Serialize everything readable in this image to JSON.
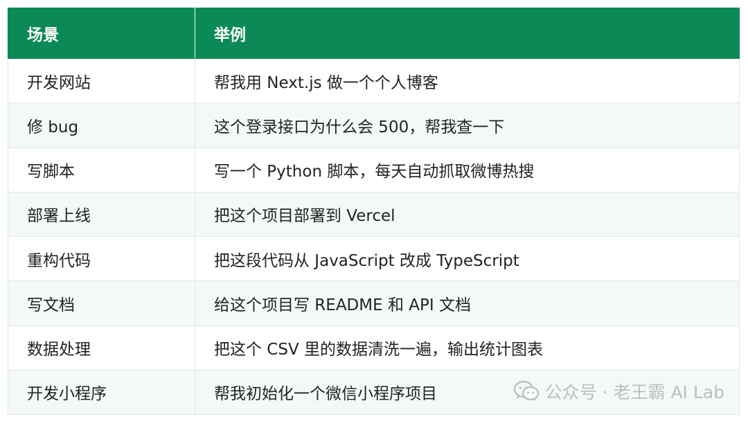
{
  "table": {
    "headers": [
      "场景",
      "举例"
    ],
    "rows": [
      {
        "scene": "开发网站",
        "example": "帮我用 Next.js 做一个个人博客"
      },
      {
        "scene": "修 bug",
        "example": "这个登录接口为什么会 500，帮我查一下"
      },
      {
        "scene": "写脚本",
        "example": "写一个 Python 脚本，每天自动抓取微博热搜"
      },
      {
        "scene": "部署上线",
        "example": "把这个项目部署到 Vercel"
      },
      {
        "scene": "重构代码",
        "example": "把这段代码从 JavaScript 改成 TypeScript"
      },
      {
        "scene": "写文档",
        "example": "给这个项目写 README 和 API 文档"
      },
      {
        "scene": "数据处理",
        "example": "把这个 CSV 里的数据清洗一遍，输出统计图表"
      },
      {
        "scene": "开发小程序",
        "example": "帮我初始化一个微信小程序项目"
      }
    ]
  },
  "watermark": {
    "icon": "wechat-icon",
    "text": "公众号 · 老王霸 AI Lab"
  },
  "colors": {
    "header_bg": "#0b8a57",
    "header_text": "#ffffff",
    "row_alt_bg": "#f3faf5",
    "watermark": "#b9bdbb"
  }
}
